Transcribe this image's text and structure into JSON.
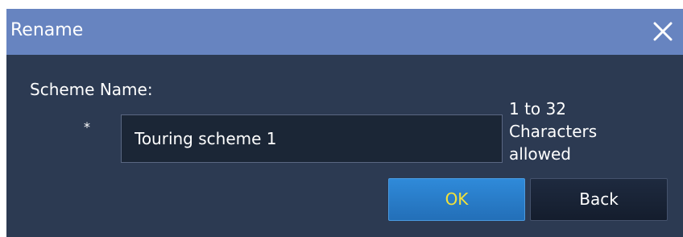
{
  "dialog": {
    "title": "Rename",
    "close_icon": "close-icon"
  },
  "form": {
    "label": "Scheme Name:",
    "required_mark": "*",
    "value": "Touring scheme 1",
    "hint_line1": "1 to 32",
    "hint_line2": "Characters",
    "hint_line3": "allowed"
  },
  "buttons": {
    "ok": "OK",
    "back": "Back"
  },
  "colors": {
    "titlebar": "#6784c0",
    "body": "#2c3a52",
    "input_bg": "#1b2636",
    "ok_bg": "#2f8ad9",
    "ok_text": "#f2e23a",
    "back_bg": "#1e2a3f"
  }
}
